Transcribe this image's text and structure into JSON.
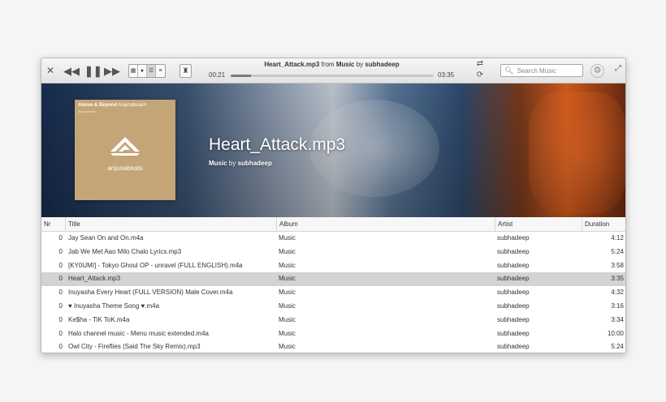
{
  "player": {
    "now_playing": {
      "title": "Heart_Attack.mp3",
      "from": "from",
      "album": "Music",
      "by": "by",
      "artist": "subhadeep"
    },
    "time_elapsed": "00:21",
    "time_total": "03:35",
    "progress": 0.098
  },
  "search": {
    "placeholder": "Search Music",
    "value": ""
  },
  "hero": {
    "title": "Heart_Attack.mp3",
    "album": "Music",
    "by": "by",
    "artist": "subhadeep",
    "cover": {
      "brand_bold": "Above & Beyond",
      "brand_light": "Anjunabeach",
      "sub": "Anjunabeats",
      "label": "anjunabeats",
      "color": "#c4a577"
    }
  },
  "icons": {
    "close": "close-icon",
    "prev": "previous-icon",
    "pause": "pause-icon",
    "next": "next-icon",
    "shuffle": "shuffle-icon",
    "repeat": "repeat-icon",
    "gear": "gear-icon",
    "maximize": "maximize-icon"
  },
  "table": {
    "columns": [
      "Nr",
      "Title",
      "Album",
      "Artist",
      "Duration"
    ],
    "selected_index": 3,
    "rows": [
      {
        "nr": "0",
        "title": "Jay Sean On and On.m4a",
        "album": "Music",
        "artist": "subhadeep",
        "duration": "4:12"
      },
      {
        "nr": "0",
        "title": "Jab We Met Aao Milo Chalo Lyrics.mp3",
        "album": "Music",
        "artist": "subhadeep",
        "duration": "5:24"
      },
      {
        "nr": "0",
        "title": "[KY0UMI] - Tokyo Ghoul OP - unravel (FULL ENGLISH).m4a",
        "album": "Music",
        "artist": "subhadeep",
        "duration": "3:58"
      },
      {
        "nr": "0",
        "title": "Heart_Attack.mp3",
        "album": "Music",
        "artist": "subhadeep",
        "duration": "3:35"
      },
      {
        "nr": "0",
        "title": "Inuyasha Every Heart (FULL VERSION) Male Cover.m4a",
        "album": "Music",
        "artist": "subhadeep",
        "duration": "4:32"
      },
      {
        "nr": "0",
        "title": "♥ Inuyasha Theme Song ♥.m4a",
        "album": "Music",
        "artist": "subhadeep",
        "duration": "3:16"
      },
      {
        "nr": "0",
        "title": "Ke$ha - TiK ToK.m4a",
        "album": "Music",
        "artist": "subhadeep",
        "duration": "3:34"
      },
      {
        "nr": "0",
        "title": "Halo channel music - Menu music extended.m4a",
        "album": "Music",
        "artist": "subhadeep",
        "duration": "10:00"
      },
      {
        "nr": "0",
        "title": "Owl City - Fireflies (Said The Sky Remix).mp3",
        "album": "Music",
        "artist": "subhadeep",
        "duration": "5:24"
      }
    ]
  }
}
